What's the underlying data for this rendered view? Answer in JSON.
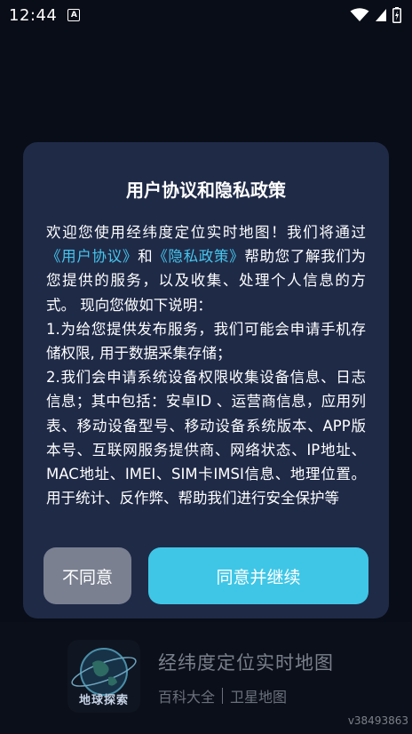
{
  "status_bar": {
    "time": "12:44",
    "notification_icon_letter": "A"
  },
  "background": {
    "app_name": "经纬度定位实时地图",
    "app_tags": [
      "百科大全",
      "卫星地图"
    ],
    "logo_text": "地球探索",
    "version": "v38493863"
  },
  "dialog": {
    "title": "用户协议和隐私政策",
    "intro_before": "欢迎您使用经纬度定位实时地图！我们将通过",
    "user_agreement_link": "《用户协议》",
    "and": "和",
    "privacy_policy_link": "《隐私政策》",
    "intro_after": "帮助您了解我们为您提供的服务，以及收集、处理个人信息的方式。 现向您做如下说明：",
    "point1": "1.为给您提供发布服务，我们可能会申请手机存储权限, 用于数据采集存储；",
    "point2": "2.我们会申请系统设备权限收集设备信息、日志信息；其中包括：安卓ID 、运营商信息，应用列表、移动设备型号、移动设备系统版本、APP版本号、互联网服务提供商、网络状态、IP地址、MAC地址、IMEI、SIM卡IMSI信息、地理位置。用于统计、反作弊、帮助我们进行安全保护等",
    "decline_label": "不同意",
    "agree_label": "同意并继续"
  },
  "colors": {
    "dialog_bg": "#1f2a47",
    "link": "#46c6ee",
    "agree_button": "#3fc6e6",
    "decline_button": "#7a8090"
  }
}
